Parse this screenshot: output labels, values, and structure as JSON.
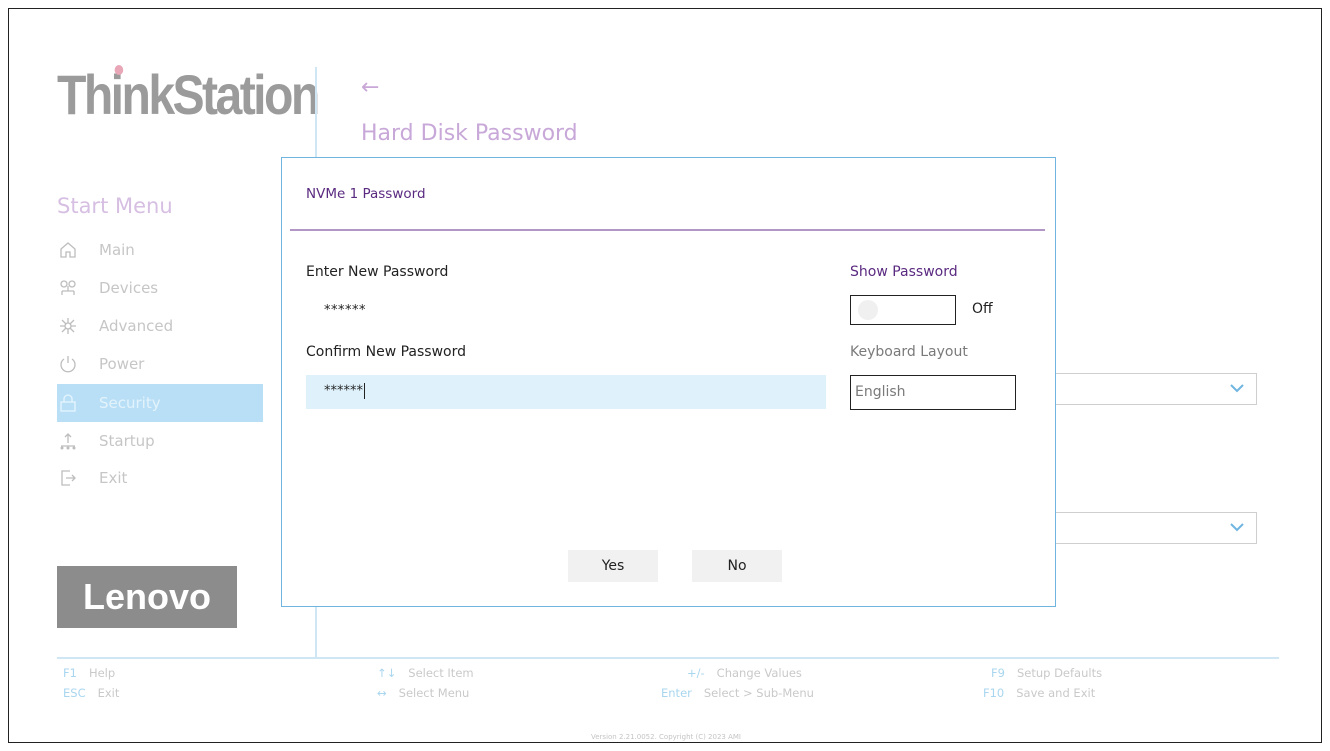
{
  "brand": {
    "product": "ThinkStation",
    "vendor": "Lenovo"
  },
  "page": {
    "title": "Hard Disk Password",
    "back_icon": "arrow-left-icon"
  },
  "sidebar": {
    "title": "Start Menu",
    "items": [
      {
        "label": "Main",
        "icon": "home-icon"
      },
      {
        "label": "Devices",
        "icon": "devices-icon"
      },
      {
        "label": "Advanced",
        "icon": "advanced-icon"
      },
      {
        "label": "Power",
        "icon": "power-icon"
      },
      {
        "label": "Security",
        "icon": "lock-icon",
        "active": true
      },
      {
        "label": "Startup",
        "icon": "startup-icon"
      },
      {
        "label": "Exit",
        "icon": "exit-icon"
      }
    ]
  },
  "dialog": {
    "title": "NVMe 1 Password",
    "enter_label": "Enter New Password",
    "enter_value": "******",
    "confirm_label": "Confirm New Password",
    "confirm_value": "******",
    "show_password_label": "Show Password",
    "show_password_state": "Off",
    "keyboard_layout_label": "Keyboard Layout",
    "keyboard_layout_value": "English",
    "yes_label": "Yes",
    "no_label": "No"
  },
  "footer": {
    "help": {
      "key": "F1",
      "label": "Help"
    },
    "exit": {
      "key": "ESC",
      "label": "Exit"
    },
    "select_item": {
      "key": "↑↓",
      "label": "Select Item"
    },
    "select_menu": {
      "key": "↔",
      "label": "Select Menu"
    },
    "change_values": {
      "key": "+/-",
      "label": "Change Values"
    },
    "submenu": {
      "key": "Enter",
      "label": "Select > Sub-Menu"
    },
    "defaults": {
      "key": "F9",
      "label": "Setup Defaults"
    },
    "save_exit": {
      "key": "F10",
      "label": "Save and Exit"
    },
    "version": "Version 2.21.0052. Copyright (C) 2023 AMI"
  },
  "colors": {
    "accent_purple": "#5a2a80",
    "accent_blue": "#6fb5e0",
    "active_nav": "#b9dff7",
    "field_bg": "#dff2fc"
  }
}
